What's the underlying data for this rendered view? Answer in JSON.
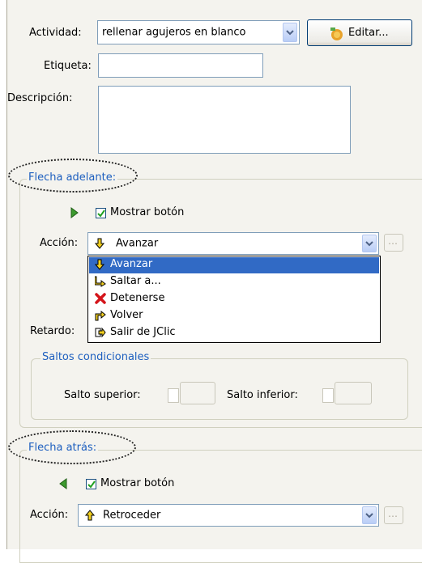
{
  "activity": {
    "label": "Actividad:",
    "selected": "rellenar agujeros en blanco",
    "edit_button": "Editar..."
  },
  "tag": {
    "label": "Etiqueta:",
    "value": ""
  },
  "description": {
    "label": "Descripción:",
    "value": ""
  },
  "forward": {
    "legend": "Flecha adelante:",
    "show_button": "Mostrar botón",
    "action_label": "Acción:",
    "action_selected": "Avanzar",
    "delay_label": "Retardo:",
    "menu": [
      {
        "label": "Avanzar",
        "icon": "arrow-down-yellow-icon",
        "selected": true
      },
      {
        "label": "Saltar a...",
        "icon": "jump-arrow-icon",
        "selected": false
      },
      {
        "label": "Detenerse",
        "icon": "red-x-icon",
        "selected": false
      },
      {
        "label": "Volver",
        "icon": "return-arrow-icon",
        "selected": false
      },
      {
        "label": "Salir de JClic",
        "icon": "exit-arrow-icon",
        "selected": false
      }
    ],
    "conditional": {
      "legend": "Saltos condicionales",
      "upper": "Salto superior:",
      "lower": "Salto inferior:"
    }
  },
  "back": {
    "legend": "Flecha atrás:",
    "show_button": "Mostrar botón",
    "action_label": "Acción:",
    "action_selected": "Retroceder"
  },
  "colors": {
    "legend": "#1d5fbf",
    "selection": "#316ac5",
    "panel": "#f4f3ee"
  }
}
